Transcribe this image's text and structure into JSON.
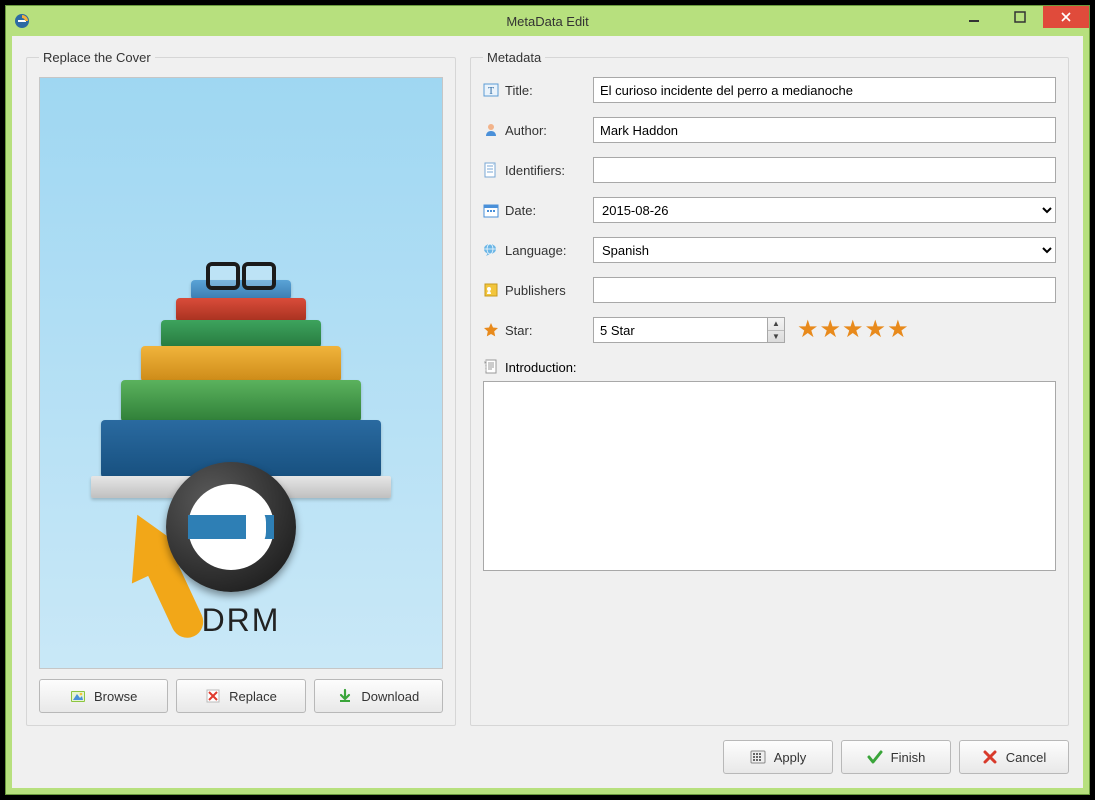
{
  "window": {
    "title": "MetaData Edit"
  },
  "cover": {
    "legend": "Replace the Cover",
    "drm_text": "DRM",
    "buttons": {
      "browse": "Browse",
      "replace": "Replace",
      "download": "Download"
    }
  },
  "metadata": {
    "legend": "Metadata",
    "labels": {
      "title": "Title:",
      "author": "Author:",
      "identifiers": "Identifiers:",
      "date": "Date:",
      "language": "Language:",
      "publishers": "Publishers",
      "star": "Star:",
      "introduction": "Introduction:"
    },
    "values": {
      "title": "El curioso incidente del perro a medianoche",
      "author": "Mark Haddon",
      "identifiers": "",
      "date": "2015-08-26",
      "language": "Spanish",
      "publishers": "",
      "star_text": "5 Star",
      "star_count": 5,
      "introduction": ""
    }
  },
  "footer": {
    "apply": "Apply",
    "finish": "Finish",
    "cancel": "Cancel"
  }
}
